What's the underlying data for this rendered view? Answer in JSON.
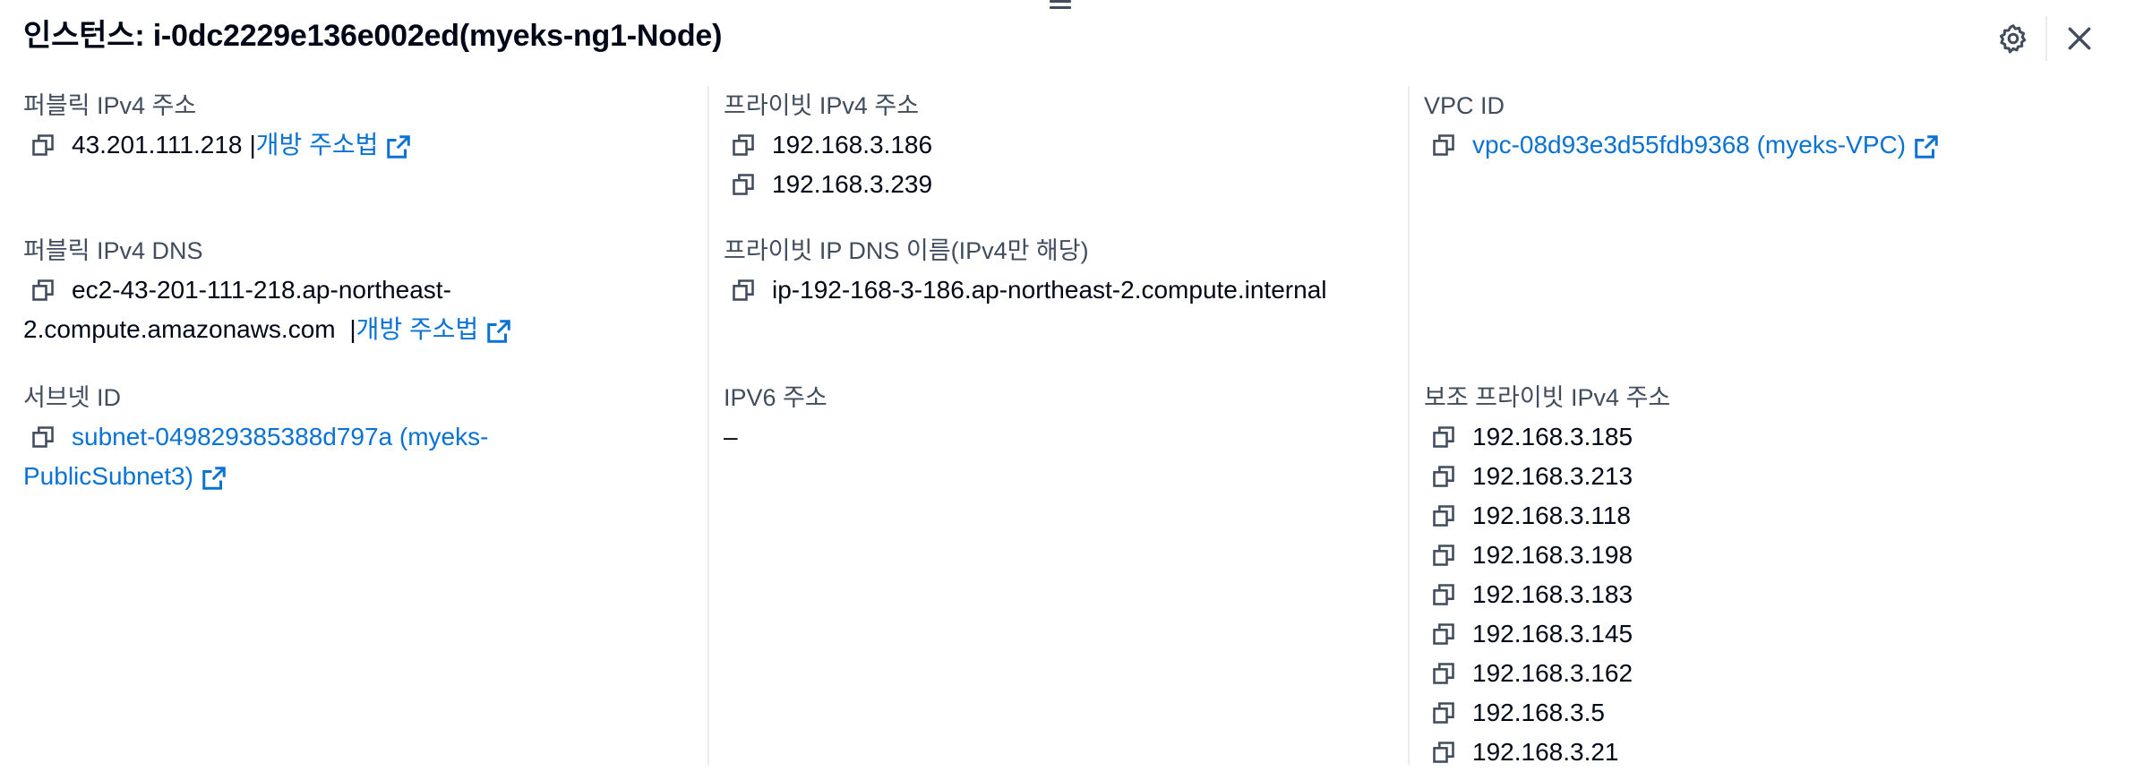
{
  "drawer": {
    "title": "인스턴스: i-0dc2229e136e002ed(myeks-ng1-Node)",
    "settings_icon": "gear-icon",
    "close_icon": "close-icon"
  },
  "details": {
    "public_ipv4": {
      "label": "퍼블릭 IPv4 주소",
      "value": "43.201.111.218",
      "separator": "|",
      "open_link": "개방 주소법"
    },
    "private_ipv4": {
      "label": "프라이빗 IPv4 주소",
      "values": [
        "192.168.3.186",
        "192.168.3.239"
      ]
    },
    "vpc_id": {
      "label": "VPC ID",
      "link": "vpc-08d93e3d55fdb9368 (myeks-VPC)"
    },
    "public_dns": {
      "label": "퍼블릭 IPv4 DNS",
      "line1": "ec2-43-201-111-218.ap-northeast-",
      "line2": "2.compute.amazonaws.com",
      "separator": "|",
      "open_link": "개방 주소법"
    },
    "private_dns": {
      "label": "프라이빗 IP DNS 이름(IPv4만 해당)",
      "value": "ip-192-168-3-186.ap-northeast-2.compute.internal"
    },
    "subnet_id": {
      "label": "서브넷 ID",
      "line1": "subnet-049829385388d797a (myeks-",
      "line2": "PublicSubnet3)"
    },
    "ipv6": {
      "label": "IPV6 주소",
      "value": "–"
    },
    "secondary_private_ipv4": {
      "label": "보조 프라이빗 IPv4 주소",
      "values": [
        "192.168.3.185",
        "192.168.3.213",
        "192.168.3.118",
        "192.168.3.198",
        "192.168.3.183",
        "192.168.3.145",
        "192.168.3.162",
        "192.168.3.5",
        "192.168.3.21"
      ]
    }
  },
  "colors": {
    "link": "#0972d3",
    "label": "#414d5c",
    "text": "#000716",
    "divider": "#e9ebed"
  }
}
